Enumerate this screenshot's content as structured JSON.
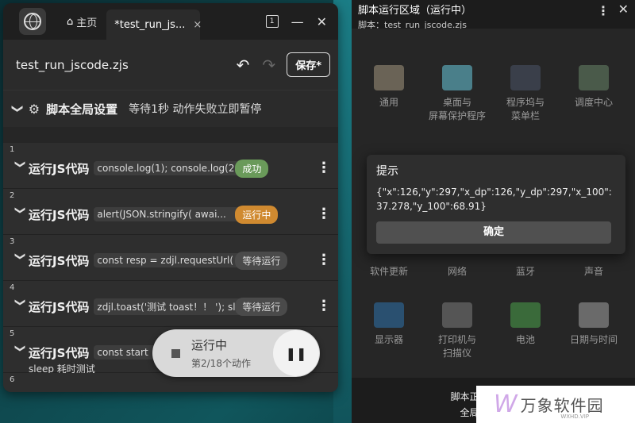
{
  "left": {
    "tabs": {
      "home": "主页",
      "active": "*test_run_js..."
    },
    "file_name": "test_run_jscode.zjs",
    "save_label": "保存*",
    "global": {
      "title": "脚本全局设置",
      "meta": "等待1秒   动作失败立即暂停"
    },
    "steps": [
      {
        "num": "1",
        "title": "运行JS代码",
        "code": "console.log(1); console.log(2...",
        "status": "成功"
      },
      {
        "num": "2",
        "title": "运行JS代码",
        "code": "alert(JSON.stringify( awai...",
        "status": "运行中"
      },
      {
        "num": "3",
        "title": "运行JS代码",
        "code": "const resp = zdjl.requestUrl(",
        "status": "等待运行"
      },
      {
        "num": "4",
        "title": "运行JS代码",
        "code": "zdjl.toast('测试 toast！！ '); sle",
        "status": "等待运行"
      },
      {
        "num": "5",
        "title": "运行JS代码",
        "code": "const start",
        "sub": "sleep 耗时测试"
      },
      {
        "num": "6"
      }
    ],
    "run_pill": {
      "title": "运行中",
      "progress": "第2/18个动作"
    }
  },
  "right": {
    "title": "脚本运行区域（运行中）",
    "script": "脚本：test_run_jscode.zjs",
    "prefs": [
      {
        "label": "通用",
        "color": "#6a6356"
      },
      {
        "label": "桌面与\n屏幕保护程序",
        "color": "#4a7f8a"
      },
      {
        "label": "程序坞与\n菜单栏",
        "color": "#3a3f4a"
      },
      {
        "label": "调度中心",
        "color": "#4a5a4a"
      },
      {
        "label": "软件更新",
        "color": "#4a5560"
      },
      {
        "label": "网络",
        "color": "#3a4a66"
      },
      {
        "label": "蓝牙",
        "color": "#2a4e7a"
      },
      {
        "label": "声音",
        "color": "#555"
      },
      {
        "label": "显示器",
        "color": "#2a5070"
      },
      {
        "label": "打印机与\n扫描仪",
        "color": "#555"
      },
      {
        "label": "电池",
        "color": "#3a6a3a"
      },
      {
        "label": "日期与时间",
        "color": "#6a6a6a"
      }
    ],
    "footer": [
      "脚本正在运行，请勿",
      "全局控制快捷键"
    ]
  },
  "dialog": {
    "title": "提示",
    "body": "{\"x\":126,\"y\":297,\"x_dp\":126,\"y_dp\":297,\"x_100\":37.278,\"y_100\":68.91}",
    "ok": "确定"
  },
  "watermark": {
    "brand": "万象软件园",
    "url": "WXHD.VIP"
  }
}
